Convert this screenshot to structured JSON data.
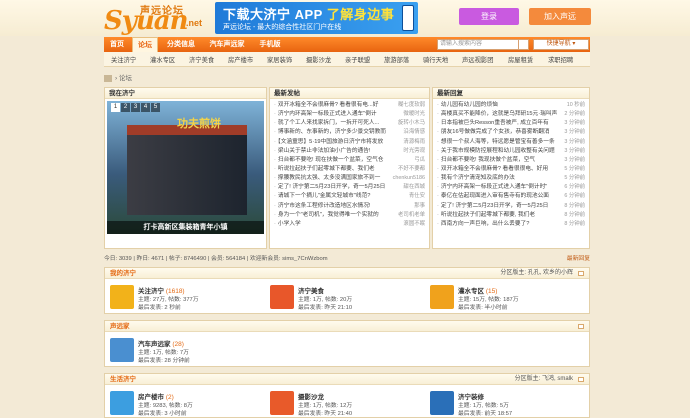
{
  "header": {
    "logo": {
      "cn": "声远论坛",
      "en": "Syuan",
      "domain": ".net"
    },
    "banner": {
      "headline_pre": "下载大济宁 APP ",
      "headline_hi": "了解身边事",
      "subline": "声远论坛 - 最大的综合性社区门户在线"
    },
    "login_label": "登录",
    "join_label": "加入声远"
  },
  "nav": {
    "items": [
      {
        "label": "首页"
      },
      {
        "label": "论坛"
      },
      {
        "label": "分类信息"
      },
      {
        "label": "汽车声远家"
      },
      {
        "label": "手机版"
      }
    ],
    "search_placeholder": "请输入搜索内容",
    "quick_nav": "快捷导航 ▾"
  },
  "subnav": [
    "关注济宁",
    "灌水专区",
    "济宁美食",
    "房产楼市",
    "家居装饰",
    "摄影沙龙",
    "亲子联盟",
    "旅游部落",
    "骑行天地",
    "声远视影团",
    "房屋租赁",
    "求职招聘"
  ],
  "breadcrumb": {
    "current": "论坛"
  },
  "featured": {
    "title": "我在济宁",
    "pages": [
      "1",
      "2",
      "3",
      "4",
      "5"
    ],
    "sign": "功夫煎饼",
    "caption": "打卡高新区集装箱青年小镇"
  },
  "latest_posts": {
    "title": "最新发帖",
    "items": [
      {
        "t": "双开冰箱全不会很麻骨? 看看很有电...好",
        "a": "糊七度软弱"
      },
      {
        "t": "济宁内环高架一标段正式进入通车\"倒计",
        "a": "微暖时光"
      },
      {
        "t": "就了个工人来找家拆门，一拆开可死人...",
        "a": "旋转小木马"
      },
      {
        "t": "博事新的、东事新的，济宁多少景交钥教而",
        "a": "沿海情感"
      },
      {
        "t": "【文涵童思】5·19中国旅游日济宁市将发放",
        "a": "清源梅雨"
      },
      {
        "t": "梁山关于禁止非法加油小广告的通告!",
        "a": "时光旁观"
      },
      {
        "t": "扫台都不要吃! 现在扶做一个盆菜，空气仓",
        "a": "弓瓜"
      },
      {
        "t": "听说拉起扶子们起零城下都要、我们老",
        "a": "不好不要都"
      },
      {
        "t": "撑腰教民抗太强、太多没满国家旅不到一",
        "a": "chenkun5186"
      },
      {
        "t": "定了! 济宁第二5月23日开学，奇一5月25日",
        "a": "甜在西城"
      },
      {
        "t": "请城下一个摘儿\"金属文轻城市\"线范?",
        "a": "青仕安"
      },
      {
        "t": "济宁市这条工程修计改造地区水情况!",
        "a": "那事"
      },
      {
        "t": "身为一个\"老司机\"，我觉得唯一个实就的",
        "a": "老司机老单"
      },
      {
        "t": "小学入学",
        "a": "滚圆不眠"
      }
    ]
  },
  "latest_replies": {
    "title": "最新回复",
    "items": [
      {
        "t": "幼儿园有幼儿园的烦恼",
        "a": "10 秒前"
      },
      {
        "t": "高楼真买不能降价，这就是乌拜研15元·瑞叫声",
        "a": "2 分钟前"
      },
      {
        "t": "日本指被巨头Resson重吾被严, 成立百年有",
        "a": "3 分钟前"
      },
      {
        "t": "朋友16号做做完成了个女孩，恭喜雾断翻消",
        "a": "3 分钟前"
      },
      {
        "t": "想很一个叔人海等，特远愿是管宝有善多一条",
        "a": "3 分钟前"
      },
      {
        "t": "关于我市规模防控展程和幼儿园收整有关问题",
        "a": "3 分钟前"
      },
      {
        "t": "扫台都不要吃! 我现扶做个盆菜，空气",
        "a": "3 分钟前"
      },
      {
        "t": "双开冰箱全不会很麻骨? 看看很很电、好用",
        "a": "5 分钟前"
      },
      {
        "t": "我有个济宁清宠知及底的办法",
        "a": "5 分钟前"
      },
      {
        "t": "济宁内环高架一标段正式进入通车\"倒计时\"",
        "a": "6 分钟前"
      },
      {
        "t": "泰亿在估起现面进入审有售寺有的现池公面",
        "a": "6 分钟前"
      },
      {
        "t": "定了! 济宁第二5月23日开学，奇一5月25日",
        "a": "8 分钟前"
      },
      {
        "t": "听说拉起扶子们起零城下都要, 我们老",
        "a": "8 分钟前"
      },
      {
        "t": "西南方向一声巨响，出什么丢要了?",
        "a": "8 分钟前"
      }
    ]
  },
  "stats": {
    "today": "今日: 3039",
    "yesterday": "昨日: 4671",
    "posts": "帖子: 8746490",
    "members": "会员: 564184",
    "welcome": "欢迎新会员: sims_7CnWzbom",
    "latest_link": "最新回复"
  },
  "categories": [
    {
      "title": "我的济宁",
      "moderator": "分区版主: 孔孔, 欢乡的小辉",
      "forums": [
        {
          "name": "关注济宁",
          "count": "(1618)",
          "meta": "主题: 27万, 帖数: 377万",
          "last": "最后发表: 2 秒前",
          "icon_color": "#f2b21a",
          "icon": "jining-focus-icon"
        },
        {
          "name": "济宁美食",
          "count": "",
          "meta": "主题: 1万, 帖数: 20万",
          "last": "最后发表: 昨天 21:10",
          "icon_color": "#e8572a",
          "icon": "food-icon"
        },
        {
          "name": "灌水专区",
          "count": "(15)",
          "meta": "主题: 15万, 帖数: 187万",
          "last": "最后发表: 半小时前",
          "icon_color": "#f0a21c",
          "icon": "lightbulb-icon"
        }
      ]
    },
    {
      "title": "声远家",
      "moderator": "",
      "forums": [
        {
          "name": "汽车声远家",
          "count": "(28)",
          "meta": "主题: 1万, 帖数: 7万",
          "last": "最后发表: 28 分钟前",
          "icon_color": "#4a8fd0",
          "icon": "car-icon"
        }
      ]
    },
    {
      "title": "生活济宁",
      "moderator": "分区版主: 飞鸿, smalk",
      "forums": [
        {
          "name": "房产楼市",
          "count": "(2)",
          "meta": "主题: 9283, 帖数: 8万",
          "last": "最后发表: 3 小时前",
          "icon_color": "#3c9ee0",
          "icon": "house-icon"
        },
        {
          "name": "摄影沙龙",
          "count": "",
          "meta": "主题: 1万, 帖数: 12万",
          "last": "最后发表: 昨天 21:40",
          "icon_color": "#e85a2a",
          "icon": "camera-icon"
        },
        {
          "name": "济宁装修",
          "count": "",
          "meta": "主题: 1万, 帖数: 5万",
          "last": "最后发表: 前天 18:57",
          "icon_color": "#2a6fb8",
          "icon": "home-decor-icon"
        }
      ]
    }
  ]
}
